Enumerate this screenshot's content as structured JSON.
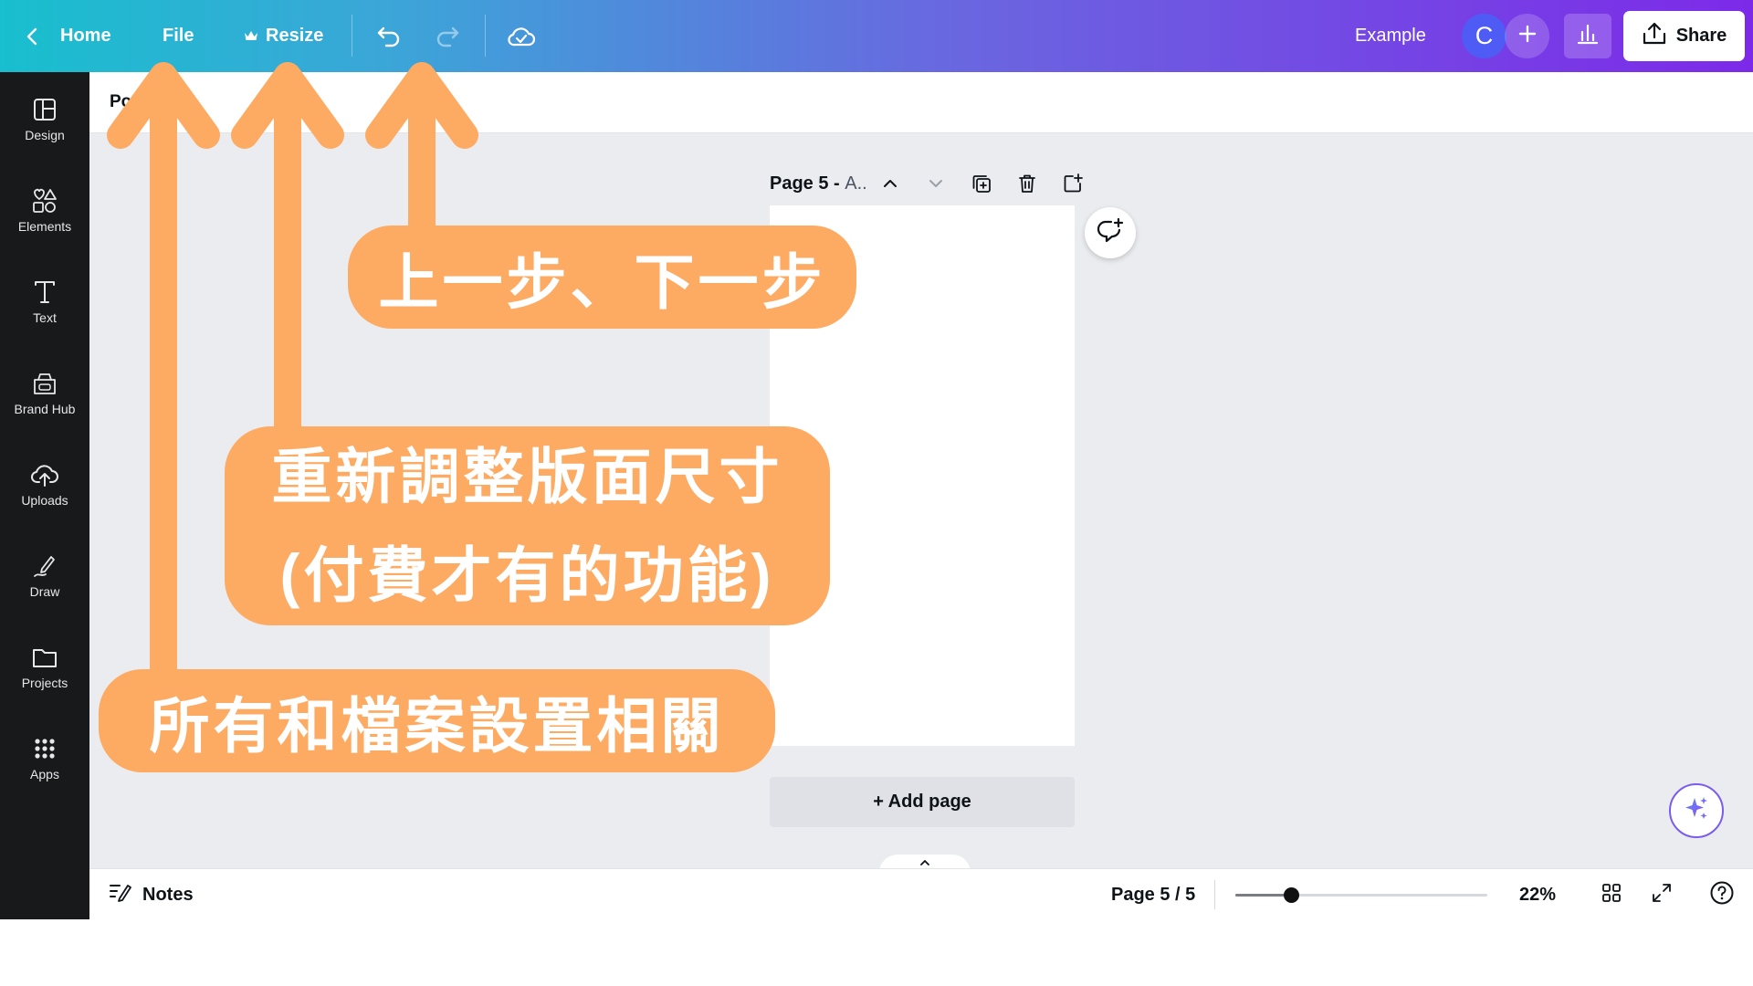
{
  "topbar": {
    "home_label": "Home",
    "file_label": "File",
    "resize_label": "Resize",
    "title": "Example",
    "avatar_initial": "C",
    "share_label": "Share",
    "icons": {
      "back": "chevron-left-icon",
      "crown": "crown-icon",
      "undo": "undo-icon",
      "redo": "redo-icon",
      "cloud": "cloud-check-icon",
      "plus": "plus-icon",
      "insights": "bar-chart-icon",
      "share": "upload-icon"
    }
  },
  "sidebar": {
    "items": [
      {
        "label": "Design",
        "icon": "layout-icon"
      },
      {
        "label": "Elements",
        "icon": "shapes-icon"
      },
      {
        "label": "Text",
        "icon": "text-icon"
      },
      {
        "label": "Brand Hub",
        "icon": "brand-hub-icon"
      },
      {
        "label": "Uploads",
        "icon": "cloud-upload-icon"
      },
      {
        "label": "Draw",
        "icon": "pen-icon"
      },
      {
        "label": "Projects",
        "icon": "folder-icon"
      },
      {
        "label": "Apps",
        "icon": "grid-icon"
      }
    ]
  },
  "page_header": {
    "title_fragment": "Po"
  },
  "canvas": {
    "page_label": "Page 5 - ",
    "page_label_suffix": "A..",
    "add_page_label": "+ Add page",
    "icons": {
      "up": "chevron-up-icon",
      "down": "chevron-down-icon",
      "duplicate": "duplicate-icon",
      "delete": "trash-icon",
      "add": "add-page-icon",
      "comment": "comment-add-icon",
      "magic": "sparkle-icon"
    }
  },
  "bottombar": {
    "notes_label": "Notes",
    "page_count": "Page 5 / 5",
    "zoom_label": "22%",
    "zoom_level": 0.22,
    "icons": {
      "notes": "notes-icon",
      "grid_view": "grid-view-icon",
      "fullscreen": "fullscreen-icon",
      "help": "help-icon",
      "collapse": "chevron-up-icon"
    }
  },
  "annotations": {
    "undo_redo": "上一步、下一步",
    "resize_line1": "重新調整版面尺寸",
    "resize_line2": "(付費才有的功能)",
    "file": "所有和檔案設置相關",
    "color": "#fdab63"
  }
}
